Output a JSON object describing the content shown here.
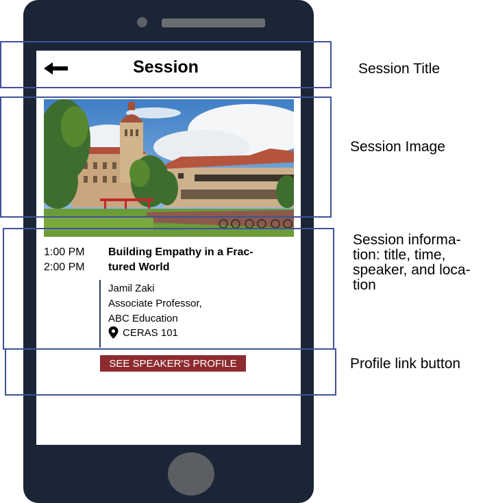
{
  "app": {
    "title": "Session",
    "back_icon": "arrow-left-icon"
  },
  "session": {
    "image_alt": "Stanford campus with Hoover Tower",
    "start_time": "1:00 PM",
    "end_time": "2:00 PM",
    "title_line1": "Building Empathy in a Frac-",
    "title_line2": "tured World",
    "speaker_name": "Jamil Zaki",
    "speaker_role": "Associate Professor,",
    "speaker_org": "ABC Education",
    "location": "CERAS 101",
    "location_icon": "map-pin-icon",
    "profile_button_label": "SEE SPEAKER'S PROFILE"
  },
  "annotations": {
    "title_label": "Session Title",
    "image_label": "Session Image",
    "info_label_line1": "Session informa-",
    "info_label_line2": "tion: title, time,",
    "info_label_line3": "speaker, and loca-",
    "info_label_line4": "tion",
    "button_label": "Profile link button"
  },
  "colors": {
    "phone_body": "#1c2535",
    "callout_border": "#3d529a",
    "button_bg": "#8d2b2e",
    "divider": "#2b3a63"
  }
}
